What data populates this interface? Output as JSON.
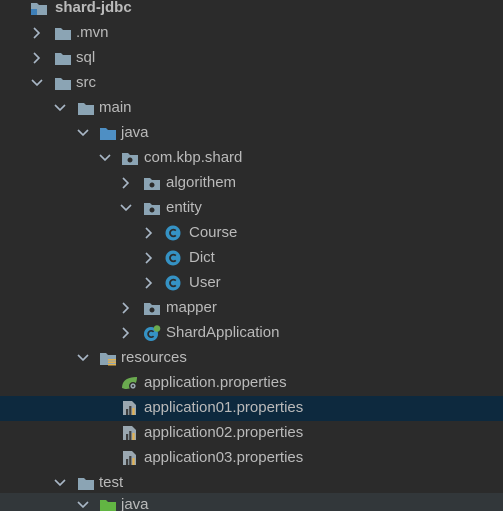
{
  "project_tree": {
    "root": {
      "label": "shard-jdbc"
    },
    "mvn": {
      "label": ".mvn"
    },
    "sql": {
      "label": "sql"
    },
    "src": {
      "label": "src"
    },
    "main": {
      "label": "main"
    },
    "java": {
      "label": "java"
    },
    "package": {
      "label": "com.kbp.shard"
    },
    "algorithem": {
      "label": "algorithem"
    },
    "entity": {
      "label": "entity"
    },
    "course": {
      "label": "Course"
    },
    "dict": {
      "label": "Dict"
    },
    "user": {
      "label": "User"
    },
    "mapper": {
      "label": "mapper"
    },
    "shard_application": {
      "label": "ShardApplication"
    },
    "resources": {
      "label": "resources"
    },
    "app_props": {
      "label": "application.properties"
    },
    "app_props01": {
      "label": "application01.properties"
    },
    "app_props02": {
      "label": "application02.properties"
    },
    "app_props03": {
      "label": "application03.properties"
    },
    "test": {
      "label": "test"
    },
    "test_java": {
      "label": "java"
    }
  },
  "colors": {
    "background": "#2b2b2b",
    "selected_row": "#0d293e",
    "text": "#bababa",
    "folder": "#8ba4b4",
    "source_folder": "#4e8fc4",
    "resources_folder_stripe": "#e0b152",
    "class_icon": "#3592c4",
    "spring_green": "#6aaa4f",
    "test_folder": "#62b543"
  },
  "icons": {
    "chevron_right": "chevron-right-icon",
    "chevron_down": "chevron-down-icon",
    "module": "module-icon",
    "folder": "folder-icon",
    "source_folder": "source-folder-icon",
    "package": "package-icon",
    "class": "class-icon",
    "spring_boot_class": "spring-boot-class-icon",
    "resources_folder": "resources-folder-icon",
    "spring_properties": "spring-properties-icon",
    "properties_file": "properties-file-icon",
    "test_source_folder": "test-source-folder-icon"
  }
}
